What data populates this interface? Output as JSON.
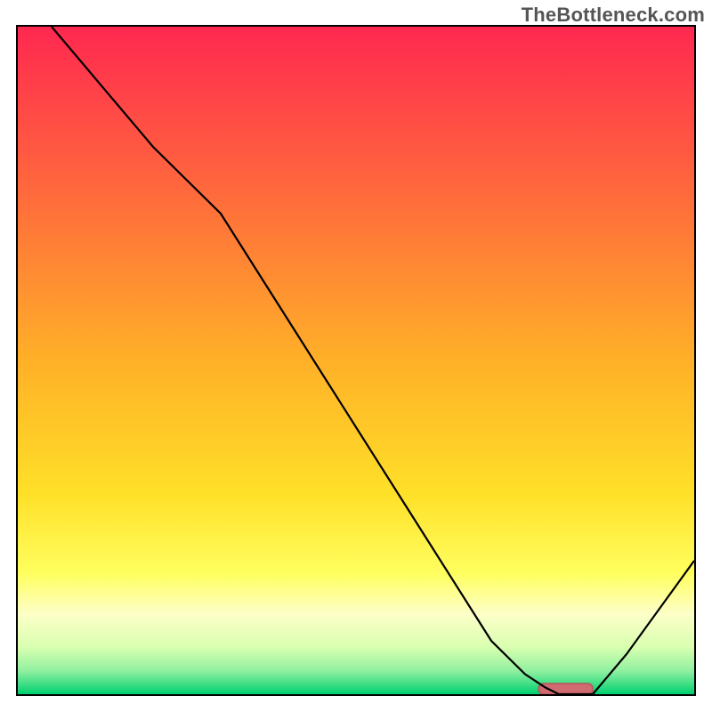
{
  "watermark": "TheBottleneck.com",
  "chart_data": {
    "type": "line",
    "title": "",
    "xlabel": "",
    "ylabel": "",
    "xlim": [
      0,
      100
    ],
    "ylim": [
      0,
      100
    ],
    "grid": false,
    "legend": false,
    "series": [
      {
        "name": "curve",
        "stroke": "#000000",
        "x": [
          5,
          10,
          15,
          20,
          25,
          30,
          35,
          40,
          45,
          50,
          55,
          60,
          65,
          70,
          75,
          78,
          80,
          82,
          85,
          90,
          95,
          100
        ],
        "y": [
          100,
          94,
          88,
          82,
          77,
          72,
          64,
          56,
          48,
          40,
          32,
          24,
          16,
          8,
          3,
          1,
          0,
          0,
          0,
          6,
          13,
          20
        ]
      },
      {
        "name": "optimal-marker",
        "type": "marker",
        "fill": "#cf6a70",
        "stroke": "#b85258",
        "x_start": 77,
        "x_end": 85,
        "y": 0
      }
    ],
    "gradient": {
      "stops": [
        {
          "offset": 0.0,
          "color": "#ff2850"
        },
        {
          "offset": 0.25,
          "color": "#ff6a3c"
        },
        {
          "offset": 0.5,
          "color": "#ffb028"
        },
        {
          "offset": 0.7,
          "color": "#ffe028"
        },
        {
          "offset": 0.82,
          "color": "#ffff60"
        },
        {
          "offset": 0.88,
          "color": "#fdffc8"
        },
        {
          "offset": 0.93,
          "color": "#d8ffb0"
        },
        {
          "offset": 0.965,
          "color": "#90f0a0"
        },
        {
          "offset": 1.0,
          "color": "#00d070"
        }
      ]
    }
  }
}
